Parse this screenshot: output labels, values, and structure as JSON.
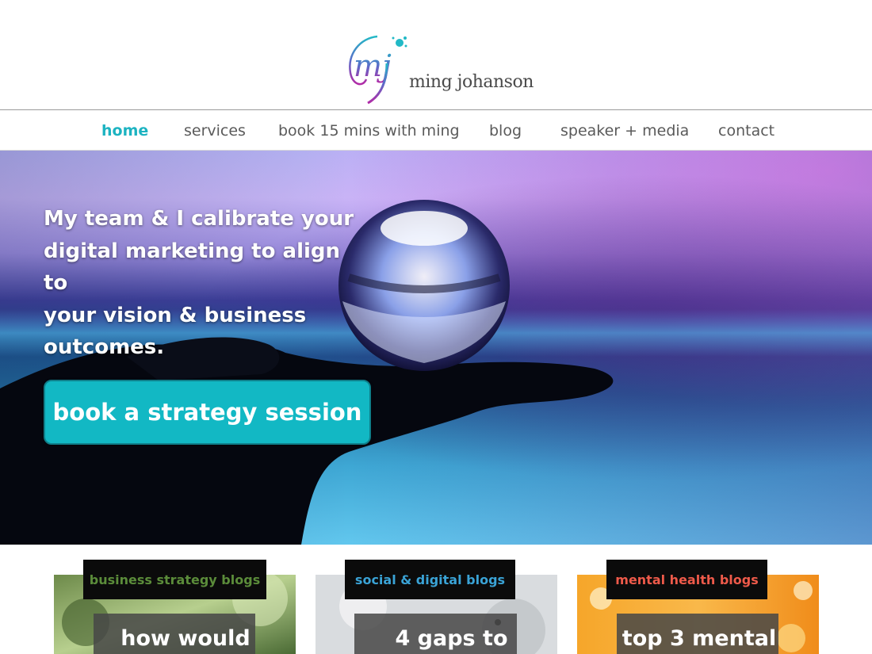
{
  "site": {
    "logo_text": "ming johanson",
    "logo_monogram": "mj"
  },
  "nav": {
    "items": [
      {
        "label": "home",
        "active": true
      },
      {
        "label": "services",
        "active": false
      },
      {
        "label": "book 15 mins with ming",
        "active": false
      },
      {
        "label": "blog",
        "active": false
      },
      {
        "label": "speaker + media",
        "active": false
      },
      {
        "label": "contact",
        "active": false
      }
    ]
  },
  "hero": {
    "headline_lines": [
      "My team & I calibrate your",
      "digital marketing to align to",
      "your vision & business",
      "outcomes."
    ],
    "cta_label": "book a strategy session"
  },
  "cards": [
    {
      "tag": "business strategy blogs",
      "tag_color": "#5b8c3a",
      "title": "how would"
    },
    {
      "tag": "social & digital blogs",
      "tag_color": "#3aa3d6",
      "title": "4 gaps to"
    },
    {
      "tag": "mental health blogs",
      "tag_color": "#ee5a4a",
      "title": "top 3 mental"
    }
  ],
  "colors": {
    "accent": "#1cb3c1",
    "cta_bg": "#12b8c4",
    "nav_text": "#5a5a5a"
  }
}
